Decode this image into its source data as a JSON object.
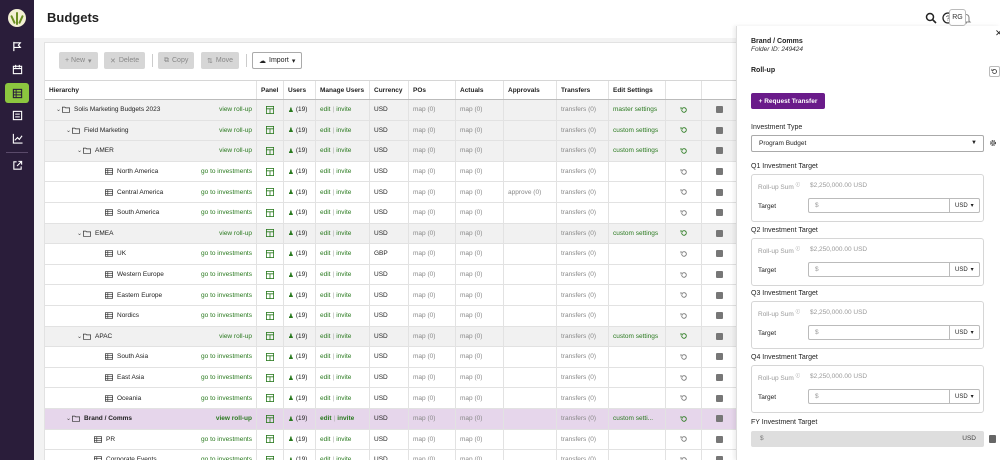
{
  "app": {
    "page_title": "Budgets",
    "avatar_initials": "RG"
  },
  "toolbar": {
    "new": "+ New",
    "delete": "Delete",
    "copy": "Copy",
    "move": "Move",
    "import": "Import"
  },
  "grid": {
    "headers": [
      "Hierarchy",
      "Panel",
      "Users",
      "Manage Users",
      "Currency",
      "POs",
      "Actuals",
      "Approvals",
      "Transfers",
      "Edit Settings"
    ],
    "rows": [
      {
        "name": "Solis Marketing Budgets 2023",
        "level": 0,
        "type": "folder",
        "link": "view roll-up",
        "users": "(19)",
        "currency": "USD",
        "pos": "map (0)",
        "actuals": "map (0)",
        "approvals": "",
        "transfers": "transfers (0)",
        "settings": "master settings",
        "style": "alt"
      },
      {
        "name": "Field Marketing",
        "level": 1,
        "type": "folder",
        "link": "view roll-up",
        "users": "(19)",
        "currency": "USD",
        "pos": "map (0)",
        "actuals": "map (0)",
        "approvals": "",
        "transfers": "transfers (0)",
        "settings": "custom settings",
        "style": "alt"
      },
      {
        "name": "AMER",
        "level": 2,
        "type": "folder",
        "link": "view roll-up",
        "users": "(19)",
        "currency": "USD",
        "pos": "map (0)",
        "actuals": "map (0)",
        "approvals": "",
        "transfers": "transfers (0)",
        "settings": "custom settings",
        "style": "alt"
      },
      {
        "name": "North America",
        "level": 3,
        "type": "table",
        "link": "go to investments",
        "users": "(19)",
        "currency": "USD",
        "pos": "map (0)",
        "actuals": "map (0)",
        "approvals": "",
        "transfers": "transfers (0)",
        "settings": "",
        "style": ""
      },
      {
        "name": "Central America",
        "level": 3,
        "type": "table",
        "link": "go to investments",
        "users": "(19)",
        "currency": "USD",
        "pos": "map (0)",
        "actuals": "map (0)",
        "approvals": "approve (0)",
        "transfers": "transfers (0)",
        "settings": "",
        "style": ""
      },
      {
        "name": "South America",
        "level": 3,
        "type": "table",
        "link": "go to investments",
        "users": "(19)",
        "currency": "USD",
        "pos": "map (0)",
        "actuals": "map (0)",
        "approvals": "",
        "transfers": "transfers (0)",
        "settings": "",
        "style": ""
      },
      {
        "name": "EMEA",
        "level": 2,
        "type": "folder",
        "link": "view roll-up",
        "users": "(19)",
        "currency": "USD",
        "pos": "map (0)",
        "actuals": "map (0)",
        "approvals": "",
        "transfers": "transfers (0)",
        "settings": "custom settings",
        "style": "alt"
      },
      {
        "name": "UK",
        "level": 3,
        "type": "table",
        "link": "go to investments",
        "users": "(19)",
        "currency": "GBP",
        "pos": "map (0)",
        "actuals": "map (0)",
        "approvals": "",
        "transfers": "transfers (0)",
        "settings": "",
        "style": ""
      },
      {
        "name": "Western Europe",
        "level": 3,
        "type": "table",
        "link": "go to investments",
        "users": "(19)",
        "currency": "USD",
        "pos": "map (0)",
        "actuals": "map (0)",
        "approvals": "",
        "transfers": "transfers (0)",
        "settings": "",
        "style": ""
      },
      {
        "name": "Eastern Europe",
        "level": 3,
        "type": "table",
        "link": "go to investments",
        "users": "(19)",
        "currency": "USD",
        "pos": "map (0)",
        "actuals": "map (0)",
        "approvals": "",
        "transfers": "transfers (0)",
        "settings": "",
        "style": ""
      },
      {
        "name": "Nordics",
        "level": 3,
        "type": "table",
        "link": "go to investments",
        "users": "(19)",
        "currency": "USD",
        "pos": "map (0)",
        "actuals": "map (0)",
        "approvals": "",
        "transfers": "transfers (0)",
        "settings": "",
        "style": ""
      },
      {
        "name": "APAC",
        "level": 2,
        "type": "folder",
        "link": "view roll-up",
        "users": "(19)",
        "currency": "USD",
        "pos": "map (0)",
        "actuals": "map (0)",
        "approvals": "",
        "transfers": "transfers (0)",
        "settings": "custom settings",
        "style": "alt"
      },
      {
        "name": "South Asia",
        "level": 3,
        "type": "table",
        "link": "go to investments",
        "users": "(19)",
        "currency": "USD",
        "pos": "map (0)",
        "actuals": "map (0)",
        "approvals": "",
        "transfers": "transfers (0)",
        "settings": "",
        "style": ""
      },
      {
        "name": "East Asia",
        "level": 3,
        "type": "table",
        "link": "go to investments",
        "users": "(19)",
        "currency": "USD",
        "pos": "map (0)",
        "actuals": "map (0)",
        "approvals": "",
        "transfers": "transfers (0)",
        "settings": "",
        "style": ""
      },
      {
        "name": "Oceania",
        "level": 3,
        "type": "table",
        "link": "go to investments",
        "users": "(19)",
        "currency": "USD",
        "pos": "map (0)",
        "actuals": "map (0)",
        "approvals": "",
        "transfers": "transfers (0)",
        "settings": "",
        "style": ""
      },
      {
        "name": "Brand / Comms",
        "level": 1,
        "type": "folder",
        "link": "view roll-up",
        "users": "(19)",
        "currency": "USD",
        "pos": "map (0)",
        "actuals": "map (0)",
        "approvals": "",
        "transfers": "transfers (0)",
        "settings": "custom setti...",
        "style": "sel"
      },
      {
        "name": "PR",
        "level": 2,
        "type": "table",
        "link": "go to investments",
        "users": "(19)",
        "currency": "USD",
        "pos": "map (0)",
        "actuals": "map (0)",
        "approvals": "",
        "transfers": "transfers (0)",
        "settings": "",
        "style": ""
      },
      {
        "name": "Corporate Events",
        "level": 2,
        "type": "table",
        "link": "go to investments",
        "users": "(19)",
        "currency": "USD",
        "pos": "map (0)",
        "actuals": "map (0)",
        "approvals": "",
        "transfers": "transfers (0)",
        "settings": "",
        "style": ""
      }
    ],
    "edit_label": "edit",
    "invite_label": "invite"
  },
  "panel": {
    "title": "Brand / Comms",
    "folder_id": "Folder ID: 249424",
    "rollup_label": "Roll-up",
    "request_transfer": "+ Request Transfer",
    "investment_type_label": "Investment Type",
    "investment_type_value": "Program Budget",
    "targets": [
      {
        "label": "Q1 Investment Target",
        "rollup_label": "Roll-up Sum",
        "rollup_value": "$2,250,000.00 USD",
        "target_label": "Target",
        "placeholder": "$",
        "currency": "USD"
      },
      {
        "label": "Q2 Investment Target",
        "rollup_label": "Roll-up Sum",
        "rollup_value": "$2,250,000.00 USD",
        "target_label": "Target",
        "placeholder": "$",
        "currency": "USD"
      },
      {
        "label": "Q3 Investment Target",
        "rollup_label": "Roll-up Sum",
        "rollup_value": "$2,250,000.00 USD",
        "target_label": "Target",
        "placeholder": "$",
        "currency": "USD"
      },
      {
        "label": "Q4 Investment Target",
        "rollup_label": "Roll-up Sum",
        "rollup_value": "$2,250,000.00 USD",
        "target_label": "Target",
        "placeholder": "$",
        "currency": "USD"
      }
    ],
    "fy_label": "FY Investment Target",
    "fy_symbol": "$",
    "fy_currency": "USD"
  },
  "colors": {
    "accent_green": "#2a7a1f",
    "purple": "#6a1b8a",
    "sidebar_bg": "#2a1d3a",
    "active_nav": "#8cc63f",
    "selected_row": "#e6d6eb"
  }
}
